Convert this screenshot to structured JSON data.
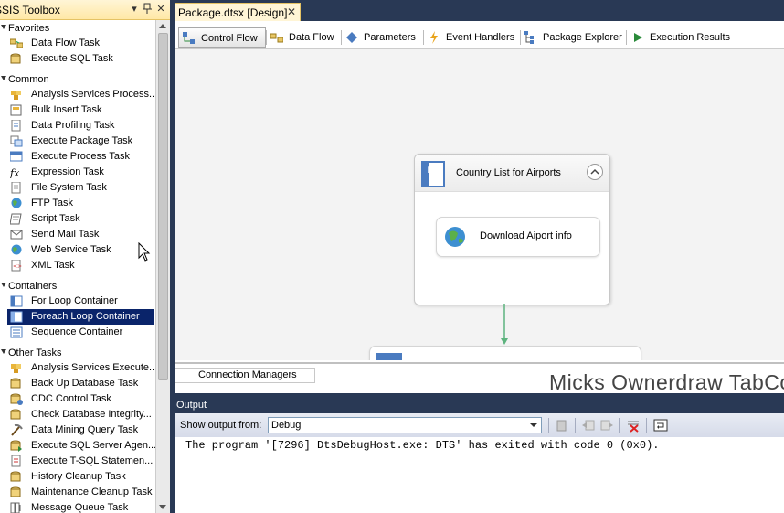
{
  "toolbox": {
    "title": "SSIS Toolbox",
    "groups": [
      {
        "label": "Favorites",
        "items": [
          "Data Flow Task",
          "Execute SQL Task"
        ]
      },
      {
        "label": "Common",
        "items": [
          "Analysis Services Process...",
          "Bulk Insert Task",
          "Data Profiling Task",
          "Execute Package Task",
          "Execute Process Task",
          "Expression Task",
          "File System Task",
          "FTP Task",
          "Script Task",
          "Send Mail Task",
          "Web Service Task",
          "XML Task"
        ]
      },
      {
        "label": "Containers",
        "items": [
          "For Loop Container",
          "Foreach Loop Container",
          "Sequence Container"
        ]
      },
      {
        "label": "Other Tasks",
        "items": [
          "Analysis Services Execute...",
          "Back Up Database Task",
          "CDC Control Task",
          "Check Database Integrity...",
          "Data Mining Query Task",
          "Execute SQL Server Agen...",
          "Execute T-SQL Statemen...",
          "History Cleanup Task",
          "Maintenance Cleanup Task",
          "Message Queue Task"
        ]
      }
    ],
    "selected_item": "Foreach Loop Container",
    "pin_icon": "pin-icon",
    "close_icon": "close-icon"
  },
  "document_tab": {
    "label": "Package.dtsx [Design]",
    "close": "✕"
  },
  "designer_tabs": [
    "Control Flow",
    "Data Flow",
    "Parameters",
    "Event Handlers",
    "Package Explorer",
    "Execution Results"
  ],
  "active_designer_tab": "Control Flow",
  "canvas": {
    "container": {
      "title": "Country List for Airports",
      "task": "Download Aiport info"
    }
  },
  "connection_managers": {
    "tab_label": "Connection Managers",
    "watermark": "Micks Ownerdraw TabControl"
  },
  "output": {
    "title": "Output",
    "show_output_from_label": "Show output from:",
    "selected_source": "Debug",
    "lines": [
      "The program '[7296] DtsDebugHost.exe: DTS' has exited with code 0 (0x0)."
    ]
  },
  "colors": {
    "selection": "#0a246a",
    "title_bar": "#ffe8a6",
    "frame": "#293955",
    "flow_arrow": "#5db37e"
  }
}
